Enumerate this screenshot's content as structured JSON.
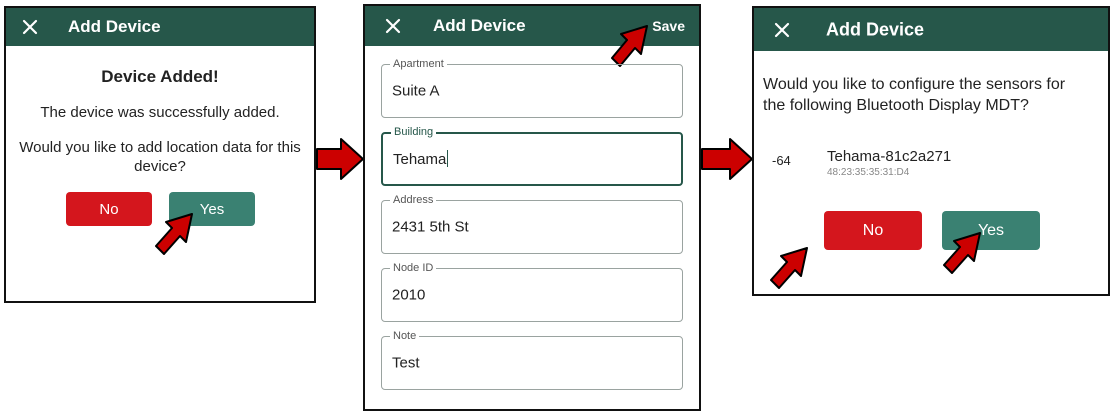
{
  "colors": {
    "appbar": "#26574a",
    "no_button": "#d4161d",
    "yes_button": "#3a8172",
    "arrow": "#cc0000"
  },
  "panel1": {
    "title": "Add Device",
    "close_icon": "close-icon",
    "heading": "Device Added!",
    "message": "The device was successfully added.",
    "question_line1": "Would you like to add location data for this",
    "question_line2": "device?",
    "no_label": "No",
    "yes_label": "Yes"
  },
  "panel2": {
    "title": "Add Device",
    "close_icon": "close-icon",
    "save_label": "Save",
    "fields": [
      {
        "label": "Apartment",
        "value": "Suite A"
      },
      {
        "label": "Building",
        "value": "Tehama"
      },
      {
        "label": "Address",
        "value": "2431 5th St"
      },
      {
        "label": "Node ID",
        "value": "2010"
      },
      {
        "label": "Note",
        "value": "Test"
      }
    ]
  },
  "panel3": {
    "title": "Add Device",
    "close_icon": "close-icon",
    "question_line1": "Would you like to configure the sensors for",
    "question_line2": "the following Bluetooth Display MDT?",
    "device": {
      "rssi": "-64",
      "name": "Tehama-81c2a271",
      "mac": "48:23:35:35:31:D4"
    },
    "no_label": "No",
    "yes_label": "Yes"
  }
}
